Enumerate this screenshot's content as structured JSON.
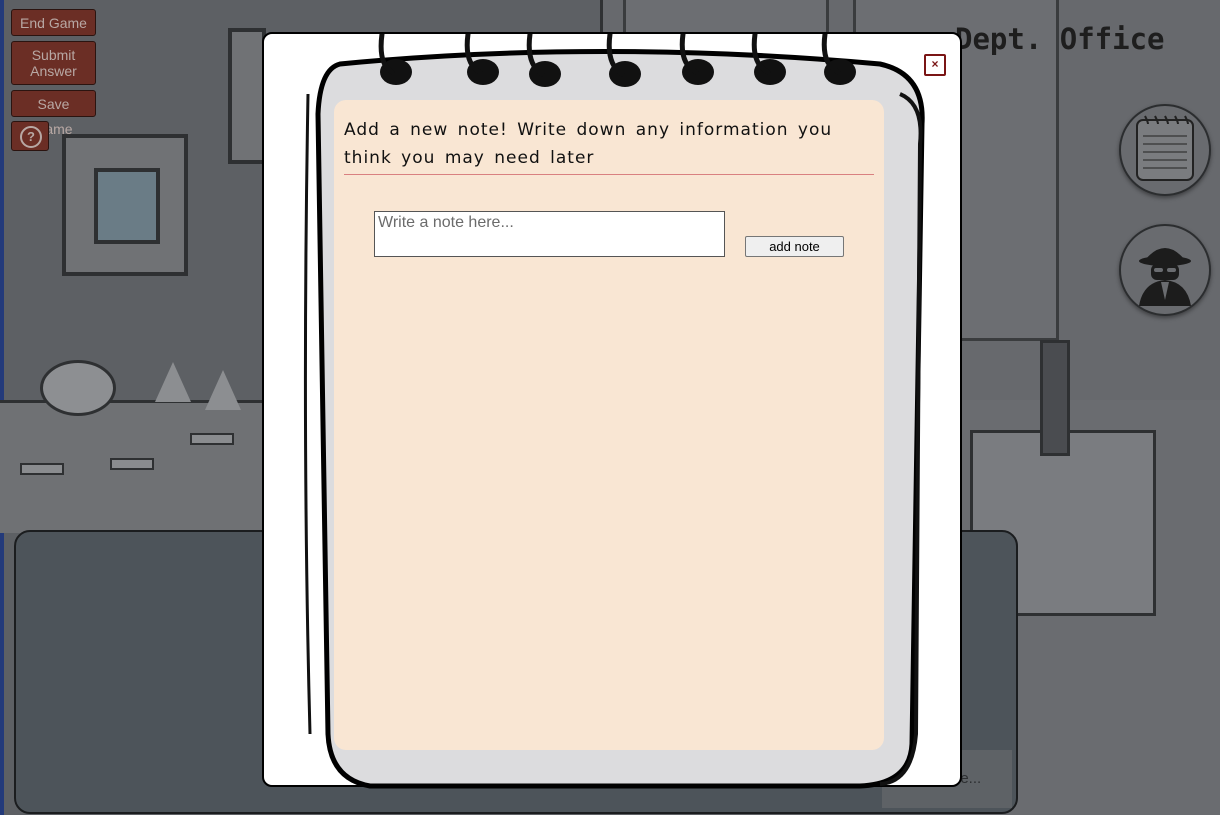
{
  "header": {
    "title": "Dept. Office"
  },
  "controls": {
    "end_game": "End Game",
    "submit_answer": "Submit Answer",
    "save_game": "Save Game",
    "help_glyph": "?"
  },
  "side_buttons": [
    {
      "icon": "notebook-icon"
    },
    {
      "icon": "detective-icon"
    }
  ],
  "dialog": {
    "continue_label": "de..."
  },
  "notes_modal": {
    "close_glyph": "×",
    "heading": "Add a new note! Write down any information you think you may need later",
    "note_input": {
      "value": "",
      "placeholder": "Write a note here..."
    },
    "add_button": "add note"
  },
  "colors": {
    "control_button_bg": "#6b2e25",
    "paper_bg": "#f9e6d3",
    "heading_rule": "#d98080",
    "close_icon": "#7a1515"
  }
}
